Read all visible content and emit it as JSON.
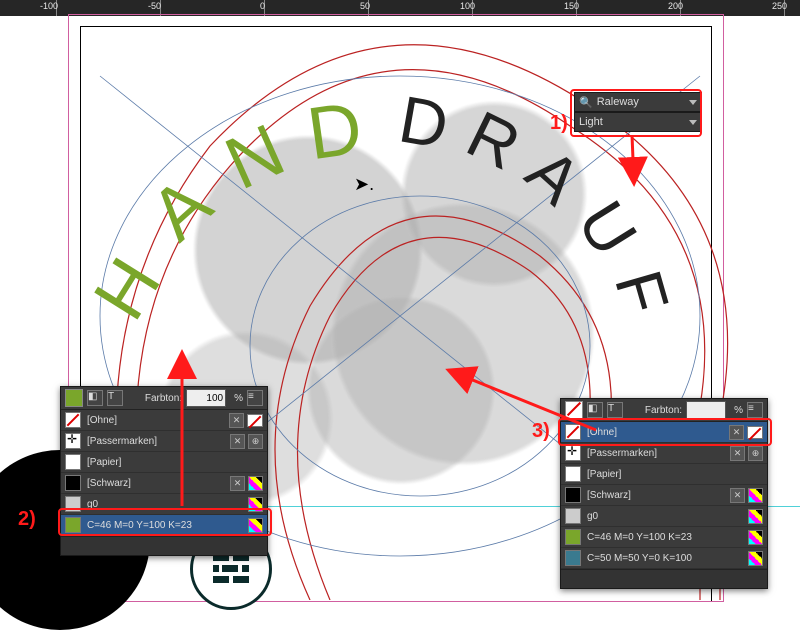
{
  "ruler": {
    "marks": [
      -100,
      -50,
      0,
      50,
      100,
      150,
      200,
      250
    ]
  },
  "artwork": {
    "word1": "HAND",
    "word2": "DRAUF"
  },
  "font_dropdown": {
    "family": "Raleway",
    "weight": "Light"
  },
  "annotations": {
    "n1": "1)",
    "n2": "2)",
    "n3": "3)"
  },
  "swatch_panel_left": {
    "tint_label": "Farbton:",
    "tint_value": "100",
    "tint_suffix": "%",
    "rows": [
      {
        "key": "none",
        "label": "[Ohne]"
      },
      {
        "key": "reg",
        "label": "[Passermarken]"
      },
      {
        "key": "paper",
        "label": "[Papier]"
      },
      {
        "key": "black",
        "label": "[Schwarz]"
      },
      {
        "key": "g0",
        "label": "g0"
      },
      {
        "key": "olive",
        "label": "C=46 M=0 Y=100 K=23"
      }
    ],
    "highlight_index": 5
  },
  "swatch_panel_right": {
    "tint_label": "Farbton:",
    "tint_value": "",
    "tint_suffix": "%",
    "rows": [
      {
        "key": "none",
        "label": "[Ohne]"
      },
      {
        "key": "reg",
        "label": "[Passermarken]"
      },
      {
        "key": "paper",
        "label": "[Papier]"
      },
      {
        "key": "black",
        "label": "[Schwarz]"
      },
      {
        "key": "g0",
        "label": "g0"
      },
      {
        "key": "olive",
        "label": "C=46 M=0 Y=100 K=23"
      },
      {
        "key": "teal",
        "label": "C=50 M=50 Y=0 K=100"
      }
    ],
    "highlight_index": 0
  },
  "colors": {
    "annot": "#ff1a1a",
    "hand": "#7aa62b",
    "bleed": "#b22222",
    "magenta": "#d15ea0"
  }
}
